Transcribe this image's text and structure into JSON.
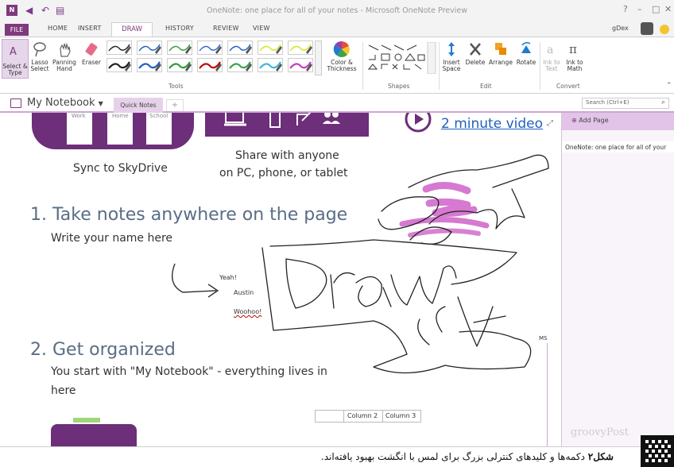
{
  "window": {
    "title": "OneNote: one place for all of your notes - Microsoft OneNote Preview",
    "user": "gDex"
  },
  "ribbon_tabs": [
    "FILE",
    "HOME",
    "INSERT",
    "DRAW",
    "HISTORY",
    "REVIEW",
    "VIEW"
  ],
  "ribbon": {
    "select_label": "Select & Type",
    "lasso_label": "Lasso Select",
    "panning_label": "Panning Hand",
    "eraser_label": "Eraser",
    "color_label": "Color & Thickness",
    "insert_space_label": "Insert Space",
    "delete_label": "Delete",
    "arrange_label": "Arrange",
    "rotate_label": "Rotate",
    "ink_to_text_label": "Ink to Text",
    "ink_to_math_label": "Ink to Math",
    "groups": {
      "tools": "Tools",
      "shapes": "Shapes",
      "edit": "Edit",
      "convert": "Convert"
    },
    "pen_colors": [
      "#222222",
      "#222222",
      "#1f5fbf",
      "#1f5fbf",
      "#2d9b3c",
      "#2d9b3c",
      "#2e66c7",
      "#c00000",
      "#1f5fbf",
      "#3aa34a",
      "#d4e614",
      "#3fb7d9",
      "#d4e614",
      "#c33cc3"
    ]
  },
  "notebook": {
    "name": "My Notebook",
    "section_tab": "Quick Notes",
    "add_tab": "+",
    "search_placeholder": "Search (Ctrl+E)"
  },
  "pagelist": {
    "add_page": "Add Page",
    "pages": [
      "OneNote: one place for all of your"
    ]
  },
  "content": {
    "devices": [
      "Work",
      "Home",
      "School"
    ],
    "sync_text": "Sync to SkyDrive",
    "share_line1": "Share with anyone",
    "share_line2": "on PC, phone, or tablet",
    "video_link": "2 minute video",
    "heading1": "1. Take notes anywhere on the page",
    "write_name": "Write your name here",
    "notes": [
      "Yeah!",
      "Austin",
      "Woohoo!"
    ],
    "heading2": "2. Get organized",
    "organized_line1": "You start with \"My Notebook\" - everything lives in",
    "organized_line2": "here",
    "columns": [
      "Column 2",
      "Column 3"
    ],
    "side_tag": "MS"
  },
  "caption": {
    "label": "شکل۲",
    "text": "دکمه‌ها و کلیدهای کنترلی بزرگ برای لمس با انگشت بهبود یافته‌اند."
  },
  "watermark": "groovyPost"
}
